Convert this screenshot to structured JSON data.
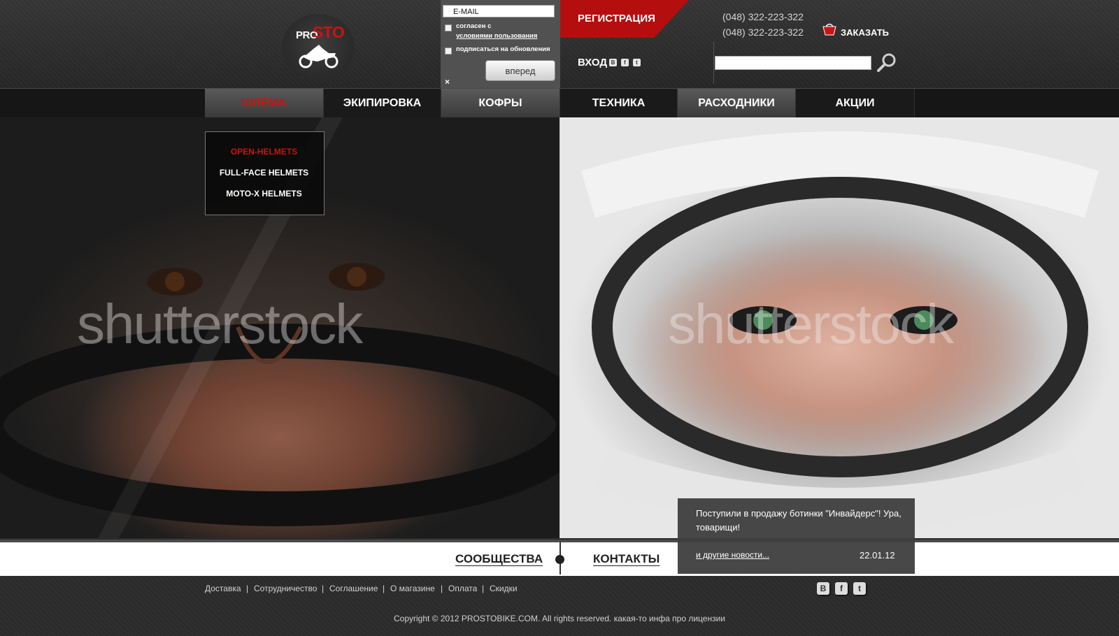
{
  "logo": {
    "pro": "PRO",
    "sto": "STO"
  },
  "login": {
    "email_placeholder": "E-MAIL",
    "agree_line1": "согласен с",
    "agree_link": "условиями пользования",
    "subscribe": "подписаться на обновления",
    "submit": "вперед",
    "close": "×"
  },
  "header": {
    "register": "РЕГИСТРАЦИЯ",
    "login": "ВХОД",
    "phones": [
      "(048) 322-223-322",
      "(048) 322-223-322"
    ],
    "order": "ЗАКАЗАТЬ",
    "social_small": [
      "В",
      "f",
      "t"
    ]
  },
  "nav": [
    {
      "label": "ШЛЕМА",
      "active": true
    },
    {
      "label": "ЭКИПИРОВКА"
    },
    {
      "label": "КОФРЫ"
    },
    {
      "label": "ТЕХНИКА"
    },
    {
      "label": "РАСХОДНИКИ"
    },
    {
      "label": "АКЦИИ"
    }
  ],
  "dropdown": [
    "OPEN-HELMETS",
    "FULL-FACE HELMETS",
    "MOTO-X HELMETS"
  ],
  "hero": {
    "watermark": "shutterstock"
  },
  "news": {
    "text": "Поступили в продажу ботинки \"Инвайдерс\"! Ура, товарищи!",
    "more": "и другие новости...",
    "date": "22.01.12"
  },
  "bar": {
    "community": "СООБЩЕСТВА",
    "contacts": "КОНТАКТЫ"
  },
  "footer": {
    "links": [
      "Доставка",
      "Сотрудничество",
      "Соглашение",
      "О магазине",
      "Оплата",
      "Скидки"
    ],
    "separator": "|",
    "social": [
      "В",
      "f",
      "t"
    ],
    "copyright": "Copyright © 2012 PROSTOBIKE.COM. All rights reserved. какая-то инфа про лицензии"
  },
  "colors": {
    "accent_red": "#b50e0e",
    "logo_red": "#c81414",
    "background": "#2a2a2a"
  }
}
